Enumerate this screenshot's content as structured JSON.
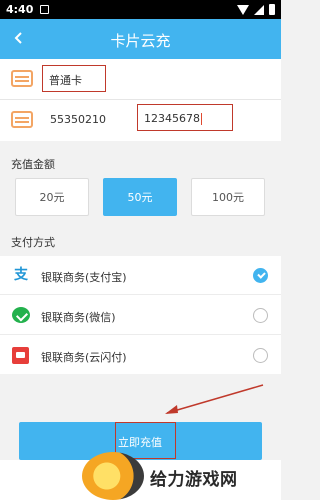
{
  "status_bar": {
    "time": "4:40",
    "icons": [
      "sim-icon",
      "wifi-icon",
      "signal-icon",
      "battery-icon"
    ]
  },
  "header": {
    "title": "卡片云充",
    "back_icon": "chevron-left-icon"
  },
  "card": {
    "type_value": "普通卡",
    "number_value": "55350210",
    "password_value": "12345678"
  },
  "amount": {
    "label": "充值金额",
    "options": [
      "20元",
      "50元",
      "100元"
    ],
    "selected": "50元"
  },
  "payment": {
    "label": "支付方式",
    "methods": [
      {
        "label": "银联商务(支付宝)",
        "icon": "alipay-icon",
        "selected": true
      },
      {
        "label": "银联商务(微信)",
        "icon": "wechat-icon",
        "selected": false
      },
      {
        "label": "银联商务(云闪付)",
        "icon": "quickpass-icon",
        "selected": false
      }
    ]
  },
  "submit": {
    "label": "立即充值"
  },
  "watermark": {
    "text": "给力游戏网"
  },
  "colors": {
    "accent": "#42b4ef",
    "highlight": "#c0392b"
  }
}
